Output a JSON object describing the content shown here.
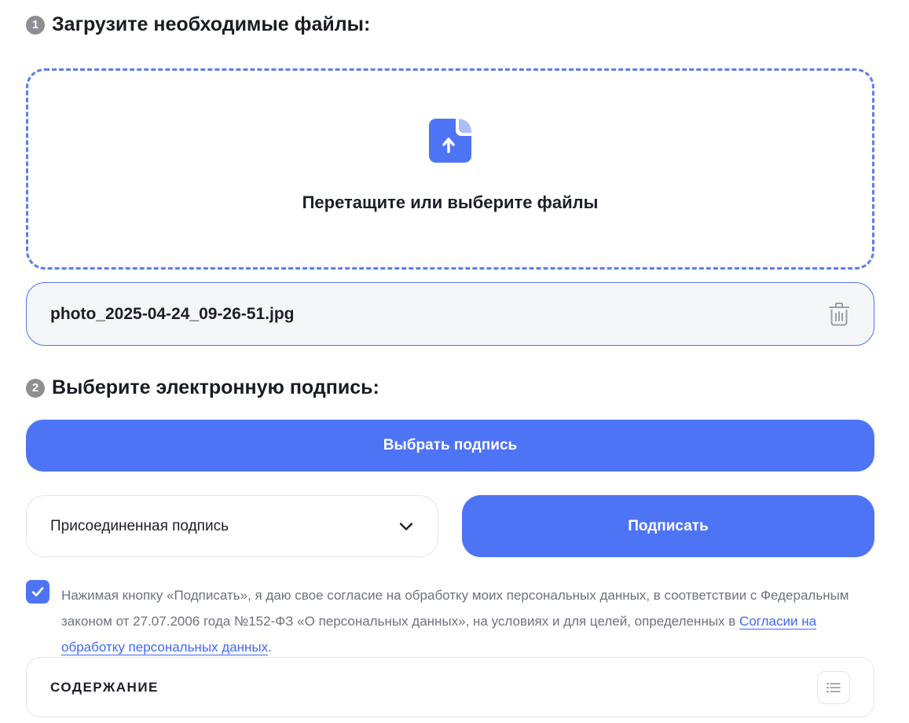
{
  "step1": {
    "number": "1",
    "title": "Загрузите необходимые файлы:"
  },
  "dropzone": {
    "text": "Перетащите или выберите файлы",
    "icon": "file-upload-icon"
  },
  "file": {
    "name": "photo_2025-04-24_09-26-51.jpg",
    "delete_icon": "trash-icon"
  },
  "step2": {
    "number": "2",
    "title": "Выберите электронную подпись:"
  },
  "choose_button": {
    "label": "Выбрать подпись"
  },
  "signature_type": {
    "value": "Присоединенная подпись",
    "icon": "chevron-down-icon"
  },
  "sign_button": {
    "label": "Подписать"
  },
  "consent": {
    "checked": true,
    "text": "Нажимая кнопку «Подписать», я даю свое согласие на обработку моих персональных данных, в соответствии с Федеральным законом от 27.07.2006 года №152-ФЗ «О персональных данных», на условиях и для целей, определенных в ",
    "link_text": "Согласии на обработку персональных данных",
    "suffix": "."
  },
  "toc": {
    "label": "СОДЕРЖАНИЕ",
    "icon": "list-icon"
  },
  "colors": {
    "accent": "#4e74f6",
    "dashed_border": "#5a7ef2",
    "muted_text": "#6e7280"
  }
}
